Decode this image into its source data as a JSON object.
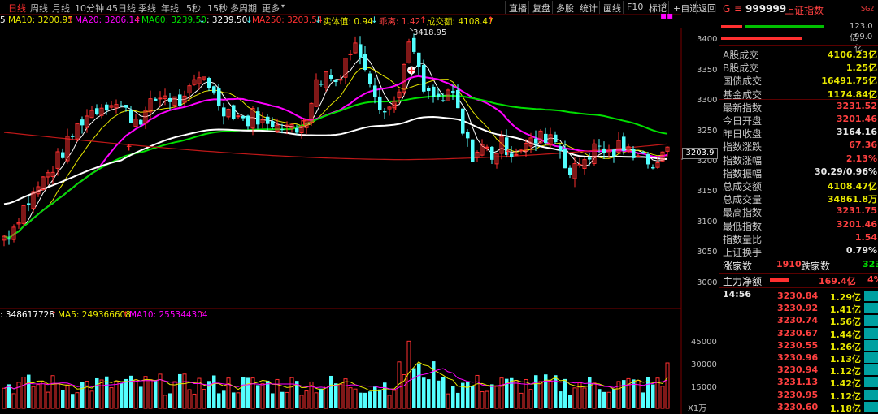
{
  "toolbar": {
    "tabs": [
      "日线",
      "周线",
      "月线",
      "10分钟",
      "45日线",
      "季线",
      "年线",
      "5秒",
      "15秒",
      "多周期",
      "更多"
    ],
    "active_tab": "日线",
    "right_buttons": [
      "直播",
      "复盘",
      "多股",
      "统计",
      "画线",
      "F10",
      "标记",
      "+自选",
      "返回"
    ]
  },
  "ma_legend": {
    "ma10": "MA10: 3200.95",
    "ma20": "MA20: 3206.14",
    "ma60": "MA60: 3239.50",
    "ma120": ": 3239.50",
    "ma250": "MA250: 3203.54",
    "body_val": "实体值: 0.94",
    "ratio": "乖离: 1.42",
    "turnover": "成交额: 4108.47"
  },
  "chart": {
    "high_label": "3418.95",
    "current_price_tag": "3203.9",
    "price_ticks": [
      "3400",
      "3350",
      "3300",
      "3250",
      "3200",
      "3150",
      "3100",
      "3050",
      "3000"
    ],
    "vol_ticks": [
      "45000",
      "30000",
      "15000"
    ],
    "vol_unit": "X1万"
  },
  "vol_legend": {
    "vol": ": 348617728",
    "ma5": "MA5: 249366608",
    "ma10": "MA10: 255344304"
  },
  "panel": {
    "symbol_prefix": "G",
    "code": "999999",
    "name": "上证指数",
    "badge": "SG2",
    "bar1_val": "123.0亿",
    "bar2_val": "99.0亿",
    "stats": [
      {
        "label": "A股成交",
        "value": "4106.23亿",
        "color": "yellow"
      },
      {
        "label": "B股成交",
        "value": "1.25亿",
        "color": "yellow"
      },
      {
        "label": "国债成交",
        "value": "16491.75亿",
        "color": "yellow"
      },
      {
        "label": "基金成交",
        "value": "1174.84亿",
        "color": "yellow"
      },
      {
        "label": "最新指数",
        "value": "3231.52",
        "color": "red"
      },
      {
        "label": "今日开盘",
        "value": "3201.46",
        "color": "red"
      },
      {
        "label": "昨日收盘",
        "value": "3164.16",
        "color": "white"
      },
      {
        "label": "指数涨跌",
        "value": "67.36",
        "color": "red"
      },
      {
        "label": "指数涨幅",
        "value": "2.13%",
        "color": "red"
      },
      {
        "label": "指数振幅",
        "value": "30.29/0.96%",
        "color": "white"
      },
      {
        "label": "总成交额",
        "value": "4108.47亿",
        "color": "yellow"
      },
      {
        "label": "总成交量",
        "value": "34861.8万",
        "color": "yellow"
      },
      {
        "label": "最高指数",
        "value": "3231.75",
        "color": "red"
      },
      {
        "label": "最低指数",
        "value": "3201.46",
        "color": "red"
      },
      {
        "label": "指数量比",
        "value": "1.54",
        "color": "red"
      },
      {
        "label": "上证换手",
        "value": "0.79%",
        "color": "white"
      }
    ],
    "up_label": "涨家数",
    "up_count": "1910",
    "down_label": "跌家数",
    "down_count": "323",
    "main_label": "主力净额",
    "main_value": "169.4亿",
    "main_pct": "4%",
    "tick_time": "14:56",
    "ticks": [
      {
        "price": "3230.84",
        "vol": "1.29亿"
      },
      {
        "price": "3230.92",
        "vol": "1.41亿"
      },
      {
        "price": "3230.74",
        "vol": "1.56亿"
      },
      {
        "price": "3230.67",
        "vol": "1.44亿"
      },
      {
        "price": "3230.55",
        "vol": "1.26亿"
      },
      {
        "price": "3230.96",
        "vol": "1.13亿"
      },
      {
        "price": "3230.94",
        "vol": "1.12亿"
      },
      {
        "price": "3231.13",
        "vol": "1.42亿"
      },
      {
        "price": "3230.95",
        "vol": "1.12亿"
      },
      {
        "price": "3230.60",
        "vol": "1.18亿"
      }
    ]
  },
  "colors": {
    "up": "#ff3030",
    "down": "#54ffff",
    "ma_white": "#ffffff",
    "ma_yellow": "#e8e800",
    "ma_magenta": "#ff00ff",
    "ma_green": "#00e000",
    "ma250": "#c01818"
  }
}
